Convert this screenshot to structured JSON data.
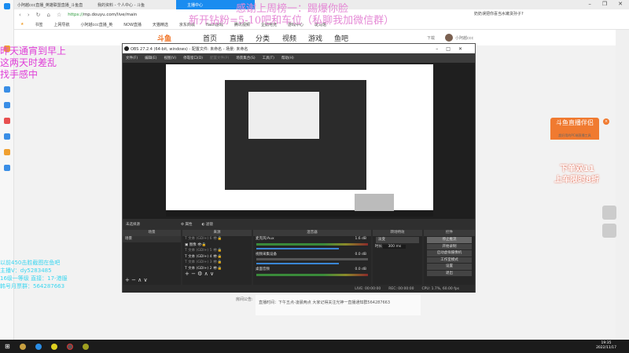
{
  "browser": {
    "tabs": [
      "小阿越ccc直播_英雄联盟直播_斗鱼直",
      "我的资料 - 个人中心 - 斗鱼",
      "主播中心"
    ],
    "url_scheme": "https://",
    "url_rest": "mp.douyu.com/live/main",
    "search_text": "奶奶误把你喜当水嫩货孙子?",
    "bookmarks": [
      "书签",
      "上网导航",
      "小阿越ccc直播_英",
      "NOW直播",
      "天猫精选",
      "京东商城",
      "flash游戏",
      "腾讯视频",
      "企鹅电竞",
      "游戏中心",
      "斑马馆"
    ]
  },
  "site_nav": {
    "logo": "斗鱼",
    "items": [
      "首页",
      "直播",
      "分类",
      "视频",
      "游戏",
      "鱼吧"
    ],
    "download": "下载",
    "username": "小阿越ccc"
  },
  "overlay": {
    "top_line1": "感谢上周榜一：踢爆你脸",
    "top_line2": "新开钻粉=5-10吧和车位（私聊我加微信群）",
    "left_pink": [
      "昨天通宵到早上",
      "这两天时差乱",
      "找手感中"
    ],
    "left_cyan": [
      "以前450击胜截图在鱼吧",
      "主播V：dy5283485",
      "16级一等级 直接：17-港服",
      "韩号月票群：564287663"
    ]
  },
  "obs": {
    "title": "OBS 27.2.4 (64-bit, windows) - 配置文件: 未命名 - 场景: 未命名",
    "menu": [
      "文件(F)",
      "编辑(E)",
      "视图(V)",
      "停靠窗口(D)",
      "配置文件(P)",
      "场景集合(S)",
      "工具(T)",
      "帮助(H)"
    ],
    "no_source": "未选择源",
    "properties": "属性",
    "filters": "滤镜",
    "docks": {
      "scenes": "场景",
      "sources": "来源",
      "mixer": "混音器",
      "transitions": "转场特效",
      "controls": "控件"
    },
    "scene_items": [
      "场景"
    ],
    "source_items": [
      "文本 (GDI+) 6",
      "图像",
      "文本 (GDI+) 5",
      "文本 (GDI+) 4",
      "文本 (GDI+) 3",
      "文本 (GDI+) 2"
    ],
    "mixer": [
      {
        "name": "麦克风/Aux",
        "db": "1.6 dB",
        "level": 0.75
      },
      {
        "name": "视频采集设备",
        "db": "0.0 dB",
        "level": 0.0
      },
      {
        "name": "桌面音频",
        "db": "0.0 dB",
        "level": 0.8
      }
    ],
    "transition": {
      "type": "淡变",
      "duration_label": "时长",
      "duration": "300 ms"
    },
    "controls": [
      "停止推流",
      "开始录制",
      "启动虚拟摄像机",
      "工作室模式",
      "设置",
      "退出"
    ],
    "status": {
      "live": "LIVE: 00:00:00",
      "rec": "REC: 00:00:00",
      "cpu": "CPU: 1.7%, 60.00 fps"
    }
  },
  "announcement": {
    "label": "房间公告:",
    "text": "直播时间：下午五点-凌晨两点 大家记得关注光神一直播通知群564287663"
  },
  "ad": {
    "title": "斗鱼直播伴侣",
    "subtitle": "超好用的PC端直播工具",
    "promo1": "下单双11",
    "promo2": "上车限时8折"
  },
  "taskbar": {
    "time": "19:35",
    "date": "2022/11/17"
  }
}
